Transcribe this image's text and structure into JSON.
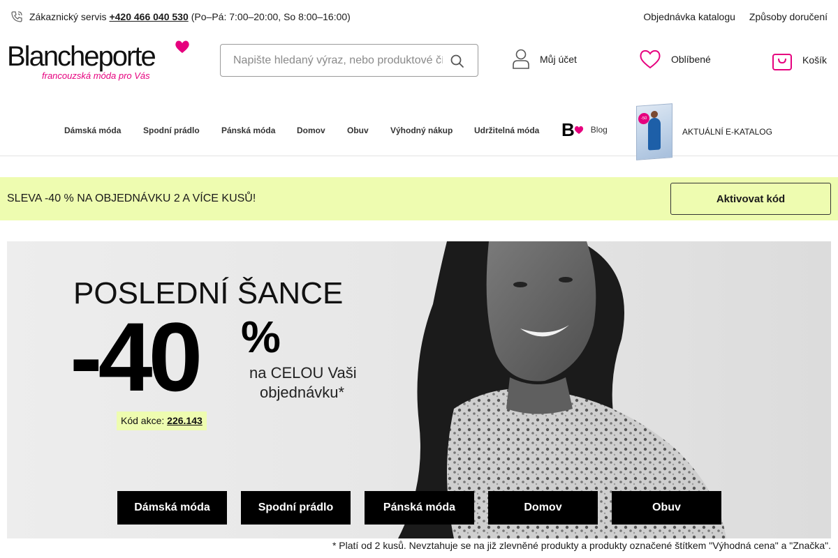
{
  "topbar": {
    "service_label": "Zákaznický servis",
    "phone": "+420 466 040 530",
    "hours": "(Po–Pá: 7:00–20:00, So 8:00–16:00)",
    "links": [
      "Objednávka katalogu",
      "Způsoby doručení"
    ]
  },
  "header": {
    "logo_text": "Blancheporte",
    "logo_tagline": "francouzská móda pro Vás",
    "search_placeholder": "Napište hledaný výraz, nebo produktové číslo",
    "account_label": "Můj účet",
    "favorites_label": "Oblíbené",
    "cart_label": "Košík"
  },
  "nav": {
    "items": [
      "Dámská móda",
      "Spodní prádlo",
      "Pánská móda",
      "Domov",
      "Obuv",
      "Výhodný nákup",
      "Udržitelná móda"
    ],
    "blog_logo": "B",
    "blog_label": "Blog",
    "catalog_badge": "-50",
    "catalog_label": "AKTUÁLNÍ E-KATALOG"
  },
  "promo": {
    "text": "SLEVA -40 % NA OBJEDNÁVKU 2 A VÍCE KUSŮ!",
    "button": "Aktivovat kód"
  },
  "hero": {
    "headline": "POSLEDNÍ ŠANCE",
    "big_number": "-40",
    "percent": "%",
    "sub_line1": "na CELOU Vaši",
    "sub_line2": "objednávku*",
    "code_label": "Kód akce:",
    "code_value": "226.143",
    "category_buttons": [
      "Dámská móda",
      "Spodní prádlo",
      "Pánská móda",
      "Domov",
      "Obuv"
    ]
  },
  "footnote": "* Platí od 2 kusů. Nevztahuje se na již zlevněné produkty a produkty označené štítkem \"Výhodná cena\" a \"Značka\".",
  "colors": {
    "brand_pink": "#e6007e",
    "promo_bg": "#eefcb0",
    "button_black": "#000000"
  }
}
